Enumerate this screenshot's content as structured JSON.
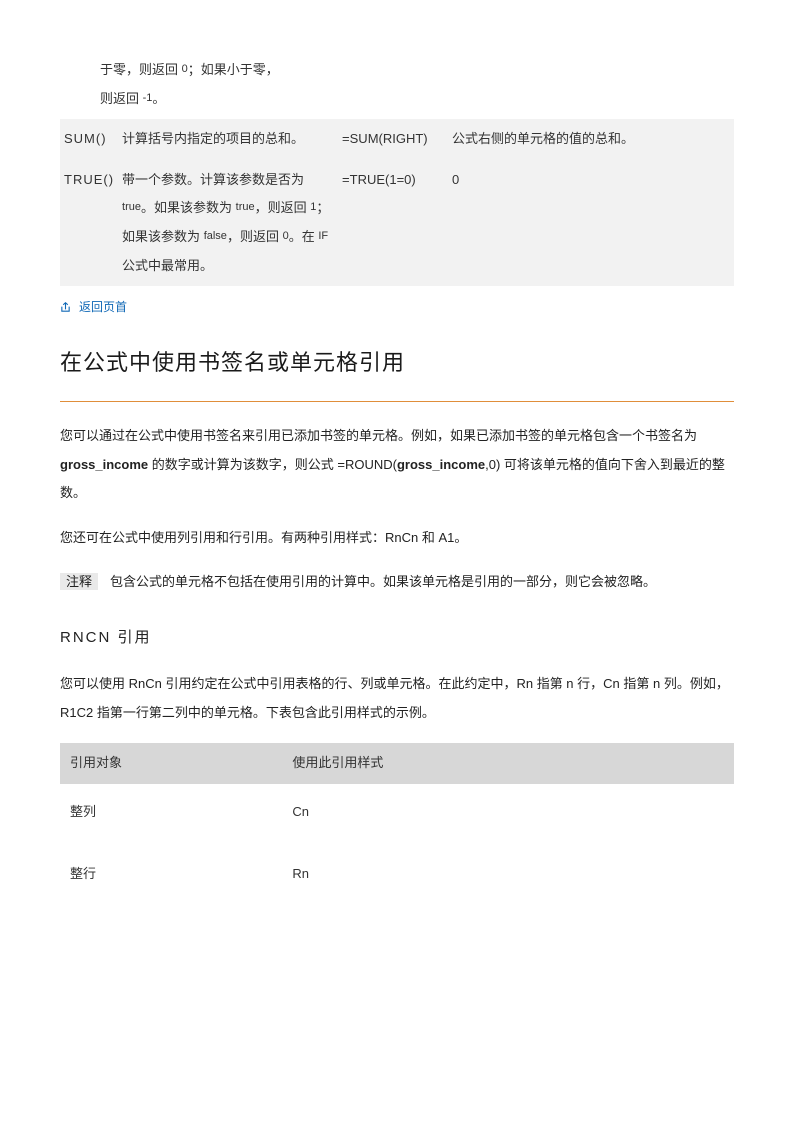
{
  "table1": {
    "prev_line1": "于零，则返回",
    "prev_zero": "0",
    "prev_line1_cont": "；如果小于零，",
    "prev_line2": "则返回",
    "prev_neg1": "-1",
    "prev_period": "。",
    "sum": {
      "name": "SUM()",
      "desc": "计算括号内指定的项目的总和。",
      "example": "=SUM(RIGHT)",
      "result": "公式右侧的单元格的值的总和。"
    },
    "true": {
      "name": "TRUE()",
      "desc_1": "带一个参数。计算该参数是否为",
      "desc_true": "true",
      "desc_2": "。如果该参数为",
      "desc_true2": "true",
      "desc_3": "，则返回",
      "desc_one": "1",
      "desc_4": "；如果该参数为",
      "desc_false": "false",
      "desc_5": "，则返回",
      "desc_zero": "0",
      "desc_6": "。在",
      "desc_if": "IF",
      "desc_7": "公式中最常用。",
      "example": "=TRUE(1=0)",
      "result": "0"
    }
  },
  "back_to_top": "返回页首",
  "heading1": "在公式中使用书签名或单元格引用",
  "para1_a": "您可以通过在公式中使用书签名来引用已添加书签的单元格。例如，如果已添加书签的单元格包含一个书签名为 ",
  "para1_b": "gross_income",
  "para1_c": " 的数字或计算为该数字，则公式 =ROUND(",
  "para1_d": "gross_income",
  "para1_e": ",0) 可将该单元格的值向下舍入到最近的整数。",
  "para2": "您还可在公式中使用列引用和行引用。有两种引用样式：RnCn 和 A1。",
  "note_label": "注释",
  "para3": "包含公式的单元格不包括在使用引用的计算中。如果该单元格是引用的一部分，则它会被忽略。",
  "heading2": "RNCN 引用",
  "para4": "您可以使用 RnCn 引用约定在公式中引用表格的行、列或单元格。在此约定中，Rn 指第 n 行，Cn 指第 n 列。例如，R1C2 指第一行第二列中的单元格。下表包含此引用样式的示例。",
  "ref_table": {
    "h1": "引用对象",
    "h2": "使用此引用样式",
    "rows": [
      {
        "obj": "整列",
        "style": "Cn"
      },
      {
        "obj": "整行",
        "style": "Rn"
      }
    ]
  }
}
